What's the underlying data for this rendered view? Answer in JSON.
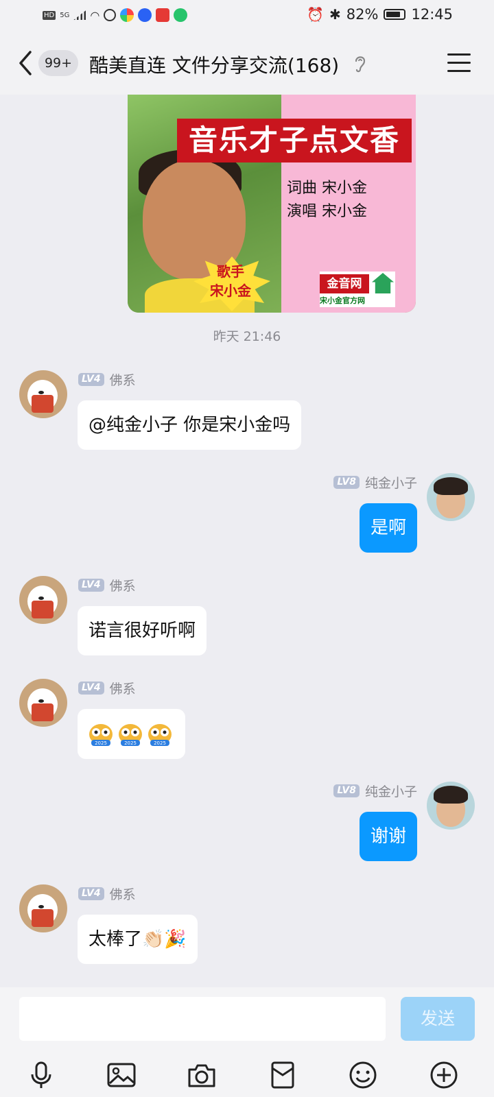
{
  "status_bar": {
    "left_badges": [
      "HD",
      "5G"
    ],
    "battery": "82%",
    "time": "12:45"
  },
  "header": {
    "unread_badge": "99+",
    "title": "酷美直连 文件分享交流(168)"
  },
  "poster": {
    "banner": "音乐才子点文香",
    "credit_line1": "词曲 宋小金",
    "credit_line2": "演唱  宋小金",
    "singer_label_1": "歌手",
    "singer_label_2": "宋小金",
    "logo_text": "金音网",
    "logo_subtext": "宋小金官方网"
  },
  "timestamp": "昨天 21:46",
  "messages": [
    {
      "side": "in",
      "level": "LV4",
      "name": "佛系",
      "text": "@纯金小子 你是宋小金吗"
    },
    {
      "side": "out",
      "level": "LV8",
      "name": "纯金小子",
      "text": "是啊"
    },
    {
      "side": "in",
      "level": "LV4",
      "name": "佛系",
      "text": "诺言很好听啊"
    },
    {
      "side": "in",
      "level": "LV4",
      "name": "佛系",
      "stickers": [
        "2025",
        "2025",
        "2025"
      ]
    },
    {
      "side": "out",
      "level": "LV8",
      "name": "纯金小子",
      "text": "谢谢"
    },
    {
      "side": "in",
      "level": "LV4",
      "name": "佛系",
      "text": "太棒了👏🏻🎉"
    }
  ],
  "composer": {
    "input_value": "",
    "send_label": "发送"
  },
  "colors": {
    "accent": "#0b99ff",
    "background": "#ededf2",
    "send_disabled": "#9cd3f8"
  }
}
